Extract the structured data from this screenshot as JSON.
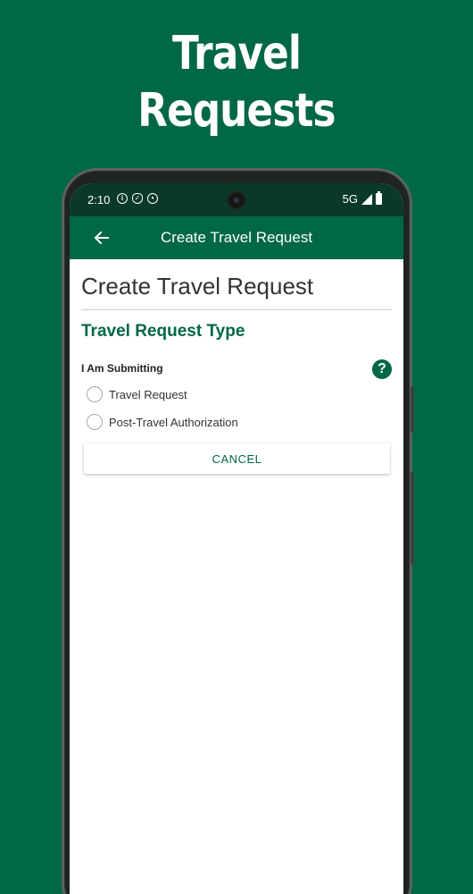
{
  "promo": {
    "headline_line1": "Travel",
    "headline_line2": "Requests"
  },
  "status_bar": {
    "time": "2:10",
    "left_icons": [
      "info-icon",
      "shield-icon",
      "face-icon"
    ],
    "network": "5G",
    "right_icons": [
      "signal-icon",
      "battery-icon"
    ]
  },
  "app_bar": {
    "back_icon": "arrow-left-icon",
    "title": "Create Travel Request"
  },
  "page": {
    "title": "Create Travel Request",
    "section_title": "Travel Request Type",
    "field_label": "I Am Submitting",
    "help_icon": "question-icon",
    "options": [
      {
        "label": "Travel Request",
        "selected": false
      },
      {
        "label": "Post-Travel Authorization",
        "selected": false
      }
    ],
    "cancel_label": "CANCEL"
  },
  "colors": {
    "brand_green": "#006843",
    "status_bar_bg": "#0a3a27",
    "text_dark": "#333333"
  }
}
